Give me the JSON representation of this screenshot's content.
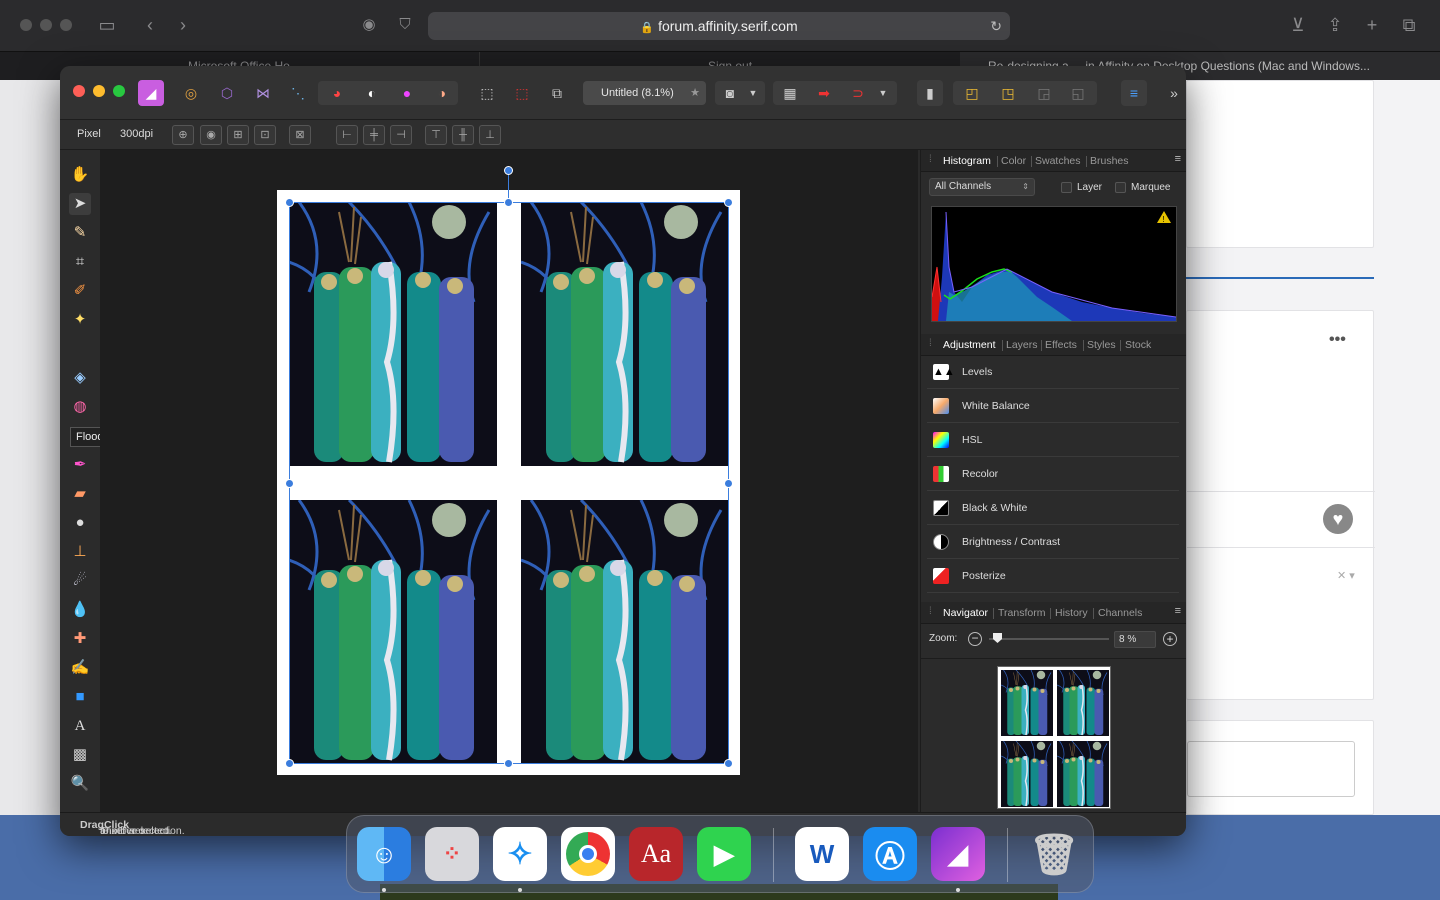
{
  "browser": {
    "url": "forum.affinity.serif.com",
    "tabs": [
      "Microsoft Office Ho...",
      "Sign out",
      "Re-designing a ... in Affinity on Desktop Questions (Mac and Windows..."
    ]
  },
  "app": {
    "document_title": "Untitled (8.1%)",
    "title_star": "★",
    "context": {
      "unit": "Pixel",
      "dpi": "300dpi"
    },
    "tooltip": "Flood Select Tool [W]",
    "status_prefix": "'Pixel' selected. ",
    "status_drag": "Drag",
    "status_middle": " to move selection. ",
    "status_click": "Click",
    "status_suffix": " another o"
  },
  "histogram_panel": {
    "tabs": [
      "Histogram",
      "Color",
      "Swatches",
      "Brushes"
    ],
    "channel_select": "All Channels",
    "checkbox_layer": "Layer",
    "checkbox_marquee": "Marquee"
  },
  "adjustment_panel": {
    "tabs": [
      "Adjustment",
      "Layers",
      "Effects",
      "Styles",
      "Stock"
    ],
    "items": [
      "Levels",
      "White Balance",
      "HSL",
      "Recolor",
      "Black & White",
      "Brightness / Contrast",
      "Posterize"
    ]
  },
  "navigator_panel": {
    "tabs": [
      "Navigator",
      "Transform",
      "History",
      "Channels"
    ],
    "zoom_label": "Zoom:",
    "zoom_value": "8 %"
  },
  "dock": {
    "apps": [
      "finder-icon",
      "launchpad-icon",
      "safari-icon",
      "chrome-icon",
      "dictionary-icon",
      "facetime-icon",
      "word-icon",
      "app-store-icon",
      "affinity-photo-icon",
      "trash-icon"
    ],
    "dictionary_label": "Aa",
    "word_label": "W"
  },
  "colors": {
    "accent": "#3b7ddd",
    "affinity": "#c95ee0"
  }
}
